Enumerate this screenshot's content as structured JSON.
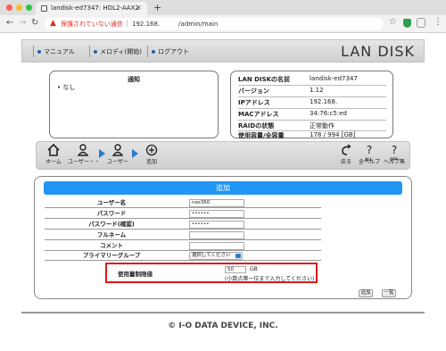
{
  "browser": {
    "tab_title": "landisk-ed7347: HDL2-AAX2",
    "new_tab_label": "+",
    "close_label": "×",
    "warning_text": "保護されていない通信",
    "url": "192.168.　　　/admin/main"
  },
  "header": {
    "links": [
      "マニュアル",
      "メロディ(開始)",
      "ログアウト"
    ],
    "brand": "LAN DISK"
  },
  "notice": {
    "title": "通知",
    "items": [
      "• なし"
    ]
  },
  "info": {
    "rows": [
      {
        "key": "LAN DISKの名前",
        "value": "landisk-ed7347"
      },
      {
        "key": "バージョン",
        "value": "1.12"
      },
      {
        "key": "IPアドレス",
        "value": "192.168."
      },
      {
        "key": "MACアドレス",
        "value": "34:76:c5:ed"
      },
      {
        "key": "RAIDの状態",
        "value": "正常動作"
      },
      {
        "key": "使用容量/全容量",
        "value": "178 / 994 [GB]"
      }
    ]
  },
  "iconbar": {
    "home": "ホーム",
    "users": "ユーザー・・",
    "user": "ユーザー",
    "add": "追加",
    "back": "戻る",
    "all_help": "全ヘルプ",
    "help_off": "ヘルプ無",
    "all_sub": "ALL",
    "off_sub": "OFF"
  },
  "form": {
    "title": "追加",
    "username_label": "ユーザー名",
    "username_value": "nas360",
    "password_label": "パスワード",
    "password_value": "••••••",
    "password_confirm_label": "パスワード(確認)",
    "password_confirm_value": "••••••",
    "fullname_label": "フルネーム",
    "comment_label": "コメント",
    "primary_group_label": "プライマリーグループ",
    "primary_group_value": "選択してください",
    "quota_label": "使用量制限値",
    "quota_value": "50",
    "quota_unit": "GB",
    "quota_hint": "(小数点第一位まで入力してください)",
    "add_button": "追加",
    "list_button": "一覧"
  },
  "footer": "© I-O DATA DEVICE, INC."
}
